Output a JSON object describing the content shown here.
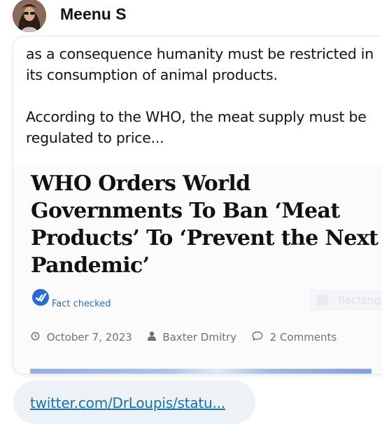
{
  "author": {
    "name": "Meenu S"
  },
  "post": {
    "paragraph1": "as a consequence humanity must be restricted in its consumption of animal products.",
    "paragraph2": "According to the WHO, the meat supply must be regulated to price..."
  },
  "embed": {
    "title": "WHO Orders World Governments To Ban ‘Meat Products’ To ‘Prevent the Next Pandemic’",
    "fact_checked": "Fact checked",
    "widget_label": "Rectang",
    "date": "October 7, 2023",
    "author": "Baxter Dmitry",
    "comments": "2 Comments"
  },
  "link": {
    "text": "twitter.com/DrLoupis/statu..."
  },
  "colors": {
    "link": "#1d6fa5",
    "fact_checked": "#2b6cc4",
    "badge": "#2a6ad1"
  },
  "icons": [
    "avatar-photo",
    "fact-check-badge-icon",
    "clock-icon",
    "user-icon",
    "comment-icon"
  ]
}
